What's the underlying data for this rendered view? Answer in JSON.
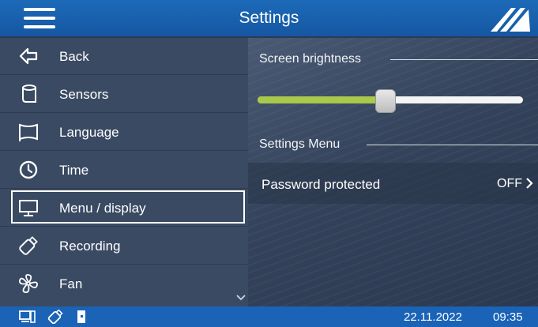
{
  "header": {
    "title": "Settings",
    "menu_icon": "hamburger-icon",
    "logo_icon": "brand-logo"
  },
  "sidebar": {
    "items": [
      {
        "label": "Back",
        "icon": "back-arrow-icon"
      },
      {
        "label": "Sensors",
        "icon": "sensors-icon"
      },
      {
        "label": "Language",
        "icon": "flag-icon"
      },
      {
        "label": "Time",
        "icon": "clock-icon"
      },
      {
        "label": "Menu / display",
        "icon": "monitor-icon",
        "active": true
      },
      {
        "label": "Recording",
        "icon": "usb-stick-icon"
      },
      {
        "label": "Fan",
        "icon": "fan-icon"
      }
    ],
    "scroll_icon": "chevron-down-icon"
  },
  "main": {
    "brightness": {
      "heading": "Screen brightness",
      "value_fraction": 0.48,
      "fill_color": "#a9c94a"
    },
    "settings_menu": {
      "heading": "Settings Menu",
      "rows": [
        {
          "label": "Password protected",
          "value": "OFF"
        }
      ]
    }
  },
  "statusbar": {
    "icons": [
      "computer-icon",
      "usb-stick-icon",
      "sd-card-icon"
    ],
    "date": "22.11.2022",
    "time": "09:35"
  },
  "colors": {
    "header": "#1557a2",
    "statusbar": "#1a63b6",
    "sidebar": "#3a4a63"
  }
}
